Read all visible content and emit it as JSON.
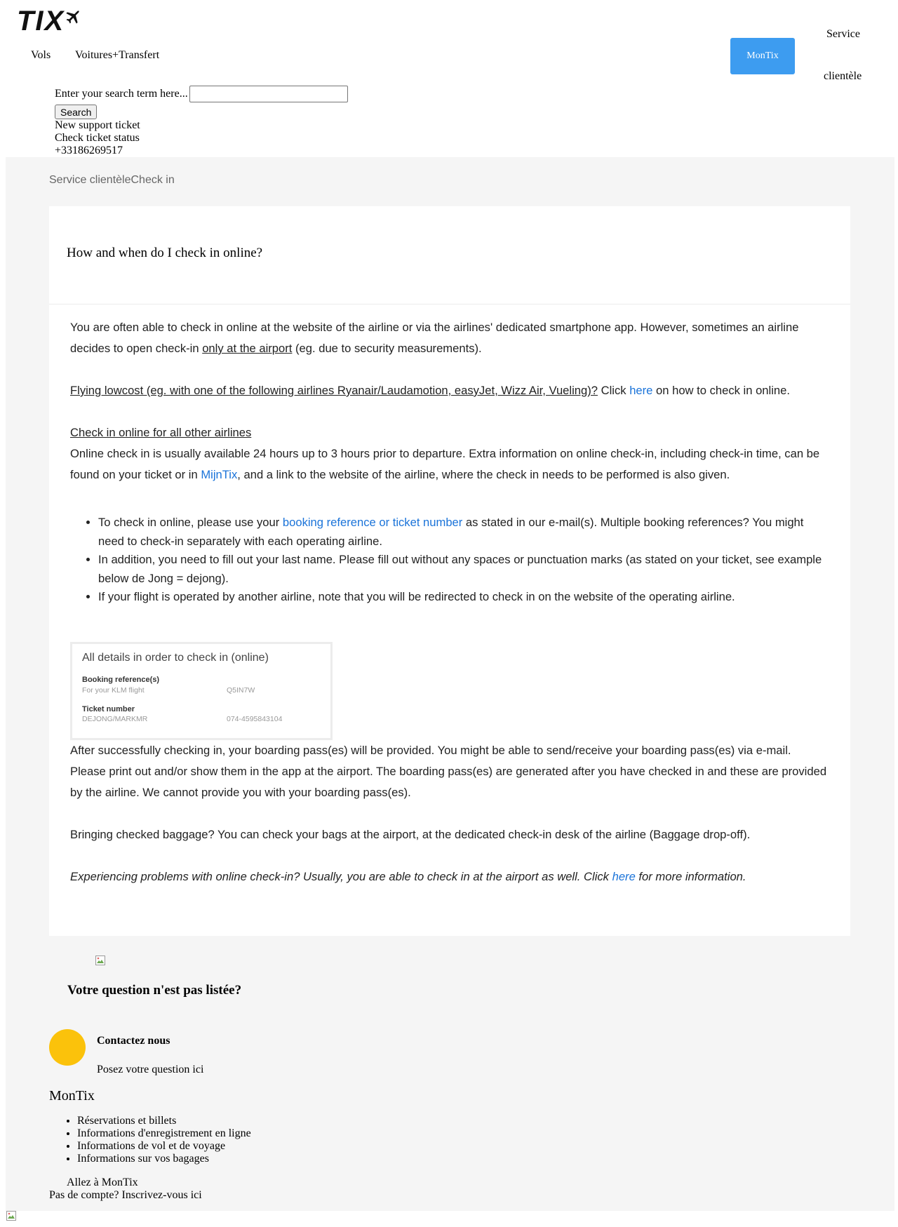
{
  "header": {
    "logo_text": "TIX",
    "nav": [
      "Vols",
      "Voitures+Transfert"
    ],
    "montix_button": "MonTix",
    "service_line1": "Service",
    "service_line2": "clientèle"
  },
  "search": {
    "label": "Enter your search term here...",
    "value": "",
    "button": "Search"
  },
  "support": {
    "new_ticket": "New support ticket",
    "check_status": "Check ticket status",
    "phone": "+33186269517"
  },
  "breadcrumb": {
    "part1": "Service clientèle",
    "part2": "Check in"
  },
  "article": {
    "title": "How and when do I check in online?",
    "p1_a": "You are often able to check in online at the website of the airline or via the airlines' dedicated smartphone app. However, sometimes an airline decides to open check-in ",
    "p1_link": "only at the airport",
    "p1_b": " (eg. due to security measurements).",
    "p2_link": "Flying lowcost (eg. with one of the following airlines Ryanair/Laudamotion, easyJet, Wizz Air, Vueling)?",
    "p2_a": " Click ",
    "p2_here": "here",
    "p2_b": " on how to check in online.",
    "p3_heading": "Check in online for all other airlines",
    "p3_a": "Online check in is usually available 24 hours up to 3 hours prior to departure. Extra information on online check-in, including check-in time, can be found on your ticket or in ",
    "p3_link": "MijnTix",
    "p3_b": ", and a link to the website of the airline, where the check in needs to be performed is also given.",
    "bullet1_a": "To check in online, please use your ",
    "bullet1_link": "booking reference or ticket number",
    "bullet1_b": " as stated in our e-mail(s). Multiple booking references? You might need to check-in separately with each operating airline.",
    "bullet2": "In addition, you need to fill out your last name. Please fill out without any spaces or punctuation marks (as stated on your ticket, see example below de Jong = dejong).",
    "bullet3": "If your flight is operated by another airline, note that you will be redirected to check in on the website of the operating airline.",
    "details_box": {
      "title": "All details in order to check in (online)",
      "booking_label": "Booking reference(s)",
      "booking_sub": "For your KLM flight",
      "booking_value": "Q5IN7W",
      "ticket_label": "Ticket number",
      "ticket_sub": "DEJONG/MARKMR",
      "ticket_value": "074-4595843104"
    },
    "p4": "After successfully checking in, your boarding pass(es) will be provided. You might be able to send/receive your boarding pass(es) via e-mail. Please print out and/or show them in the app at the airport. The boarding pass(es) are generated after you have checked in and these are provided by the airline. We cannot provide you with your boarding pass(es).",
    "p5": "Bringing checked baggage? You can check your bags at the airport, at the dedicated check-in desk of the airline (Baggage drop-off).",
    "p6_a": "Experiencing problems with online check-in? Usually, you are able to check in at the airport as well. Click ",
    "p6_here": "here",
    "p6_b": " for more information."
  },
  "question": {
    "title": "Votre question n'est pas listée?",
    "contact_title": "Contactez nous",
    "contact_sub": "Posez votre question ici"
  },
  "montix": {
    "title": "MonTix",
    "items": [
      "Réservations et billets",
      "Informations d'enregistrement en ligne",
      "Informations de vol et de voyage",
      "Informations sur vos bagages"
    ],
    "goto": "Allez à MonTix",
    "no_account": "Pas de compte? Inscrivez-vous ici"
  },
  "colors": {
    "accent": "#3d9cf0",
    "link": "#1a73d9",
    "contact_circle": "#fbc20b",
    "page_bg": "#f5f5f5"
  },
  "icons": [
    "plane-icon",
    "broken-image-icon"
  ]
}
